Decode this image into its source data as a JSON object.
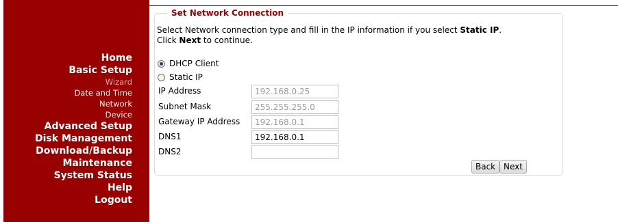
{
  "sidebar": {
    "items": [
      {
        "label": "Home",
        "kind": "main"
      },
      {
        "label": "Basic Setup",
        "kind": "main"
      },
      {
        "label": "Wizard",
        "kind": "sub-disabled"
      },
      {
        "label": "Date and Time",
        "kind": "sub"
      },
      {
        "label": "Network",
        "kind": "sub"
      },
      {
        "label": "Device",
        "kind": "sub"
      },
      {
        "label": "Advanced Setup",
        "kind": "main"
      },
      {
        "label": "Disk Management",
        "kind": "main"
      },
      {
        "label": "Download/Backup",
        "kind": "main"
      },
      {
        "label": "Maintenance",
        "kind": "main"
      },
      {
        "label": "System Status",
        "kind": "main"
      },
      {
        "label": "Help",
        "kind": "main"
      },
      {
        "label": "Logout",
        "kind": "main"
      }
    ]
  },
  "panel": {
    "title": "Set Network Connection",
    "intro_1_pre": "Select Network connection type and fill in the IP information if you select ",
    "intro_1_bold": "Static IP",
    "intro_1_post": ".",
    "intro_2_pre": "Click ",
    "intro_2_bold": "Next",
    "intro_2_post": " to continue."
  },
  "connection": {
    "dhcp_label": "DHCP Client",
    "static_label": "Static IP",
    "selected": "DHCP Client"
  },
  "fields": {
    "ip_label": "IP Address",
    "ip_value": "192.168.0.25",
    "mask_label": "Subnet Mask",
    "mask_value": "255.255.255.0",
    "gateway_label": "Gateway IP Address",
    "gateway_value": "192.168.0.1",
    "dns1_label": "DNS1",
    "dns1_value": "192.168.0.1",
    "dns2_label": "DNS2",
    "dns2_value": ""
  },
  "buttons": {
    "back": "Back",
    "next": "Next"
  },
  "colors": {
    "sidebar_bg": "#990000",
    "legend": "#990000",
    "disabled_text": "#9a9a9a"
  }
}
